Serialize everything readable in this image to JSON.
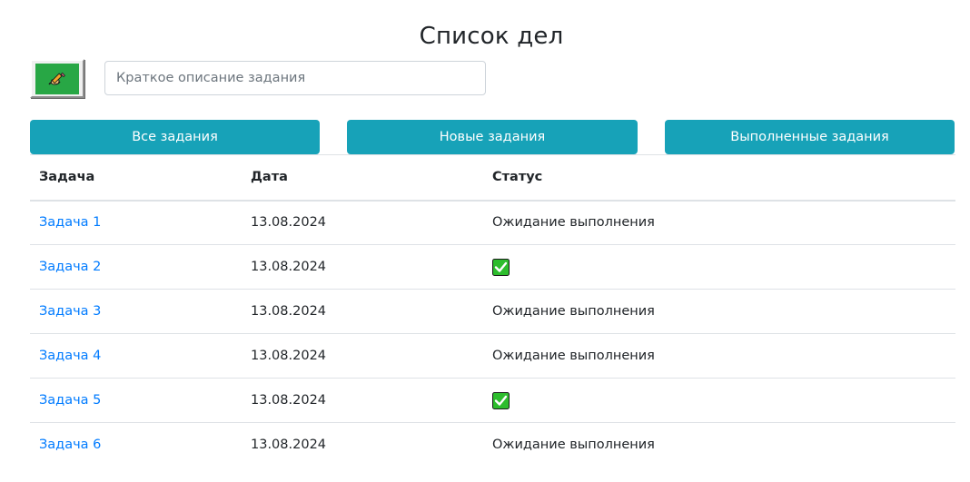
{
  "header": {
    "title": "Список дел"
  },
  "add_form": {
    "button_icon": "pencil-writing-icon",
    "input_placeholder": "Краткое описание задания",
    "input_value": ""
  },
  "filters": [
    {
      "label": "Все задания"
    },
    {
      "label": "Новые задания"
    },
    {
      "label": "Выполненные задания"
    }
  ],
  "table": {
    "columns": [
      "Задача",
      "Дата",
      "Статус"
    ],
    "rows": [
      {
        "task": "Задача 1",
        "date": "13.08.2024",
        "status": "Ожидание выполнения",
        "done": false
      },
      {
        "task": "Задача 2",
        "date": "13.08.2024",
        "status": "",
        "done": true
      },
      {
        "task": "Задача 3",
        "date": "13.08.2024",
        "status": "Ожидание выполнения",
        "done": false
      },
      {
        "task": "Задача 4",
        "date": "13.08.2024",
        "status": "Ожидание выполнения",
        "done": false
      },
      {
        "task": "Задача 5",
        "date": "13.08.2024",
        "status": "",
        "done": true
      },
      {
        "task": "Задача 6",
        "date": "13.08.2024",
        "status": "Ожидание выполнения",
        "done": false
      }
    ]
  },
  "colors": {
    "accent": "#17a2b8",
    "add_button": "#28a745",
    "link": "#007bff",
    "check_green": "#2dbd2d"
  }
}
